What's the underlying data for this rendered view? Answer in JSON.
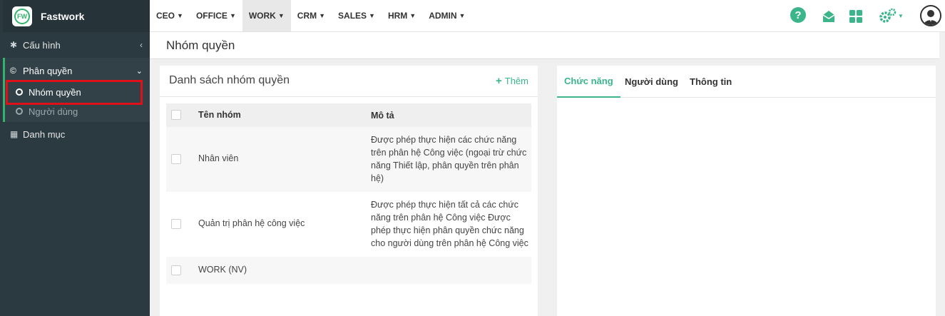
{
  "app": {
    "name": "Fastwork",
    "logo_text": "FW"
  },
  "sidebar": {
    "config": {
      "label": "Cấu hình"
    },
    "permissions": {
      "label": "Phân quyền",
      "items": [
        {
          "label": "Nhóm quyền"
        },
        {
          "label": "Người dùng"
        }
      ]
    },
    "catalog": {
      "label": "Danh mục"
    }
  },
  "nav": {
    "items": [
      {
        "label": "CEO"
      },
      {
        "label": "OFFICE"
      },
      {
        "label": "WORK"
      },
      {
        "label": "CRM"
      },
      {
        "label": "SALES"
      },
      {
        "label": "HRM"
      },
      {
        "label": "ADMIN"
      }
    ],
    "active": "WORK"
  },
  "page": {
    "title": "Nhóm quyền"
  },
  "list": {
    "title": "Danh sách nhóm quyền",
    "add_label": "Thêm",
    "columns": {
      "name": "Tên nhóm",
      "desc": "Mô tả"
    },
    "rows": [
      {
        "name": "Nhân viên",
        "desc": "Được phép thực hiện các chức năng trên phân hệ Công việc (ngoại trừ chức năng Thiết lập, phân quyền trên phân hệ)"
      },
      {
        "name": "Quản trị phân hệ công việc",
        "desc": "Được phép thực hiện tất cả các chức năng trên phân hệ Công việc Được phép thực hiện phân quyền chức năng cho người dùng trên phân hệ Công việc"
      },
      {
        "name": "WORK (NV)",
        "desc": ""
      }
    ]
  },
  "detail": {
    "tabs": [
      {
        "label": "Chức năng"
      },
      {
        "label": "Người dùng"
      },
      {
        "label": "Thông tin"
      }
    ]
  },
  "colors": {
    "accent": "#3bb58a",
    "sidebar_bg": "#2b3a40",
    "highlight": "#e0101a"
  }
}
